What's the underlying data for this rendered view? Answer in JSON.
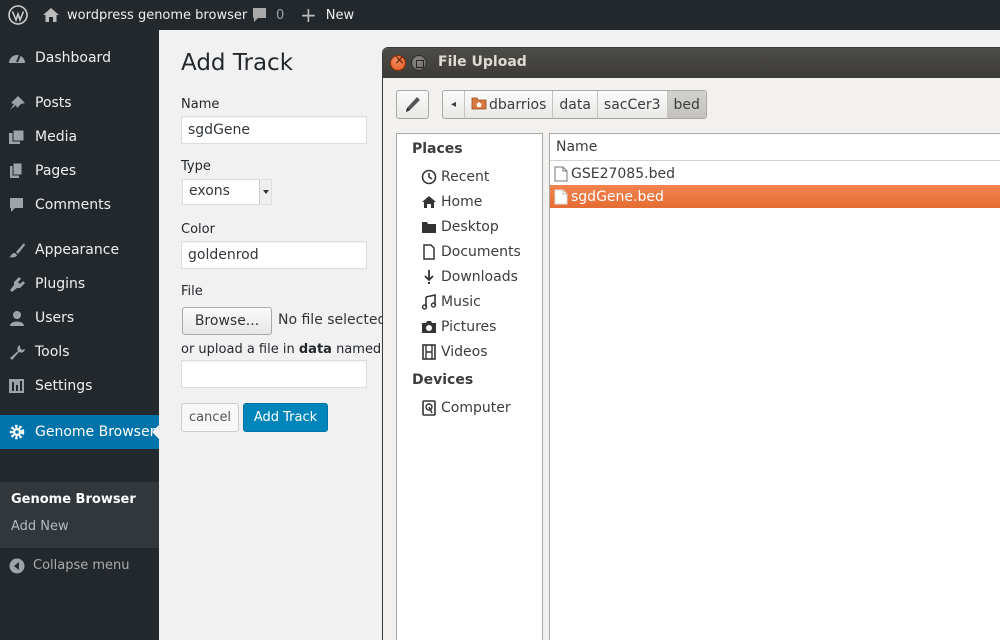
{
  "adminbar": {
    "site_name": "wordpress genome browser",
    "comments_count": "0",
    "new_label": "New"
  },
  "sidebar": {
    "items": [
      {
        "label": "Dashboard",
        "icon": "dashboard-icon"
      },
      {
        "label": "Posts",
        "icon": "pin-icon"
      },
      {
        "label": "Media",
        "icon": "media-icon"
      },
      {
        "label": "Pages",
        "icon": "pages-icon"
      },
      {
        "label": "Comments",
        "icon": "comment-icon"
      },
      {
        "label": "Appearance",
        "icon": "brush-icon"
      },
      {
        "label": "Plugins",
        "icon": "plug-icon"
      },
      {
        "label": "Users",
        "icon": "user-icon"
      },
      {
        "label": "Tools",
        "icon": "wrench-icon"
      },
      {
        "label": "Settings",
        "icon": "settings-icon"
      },
      {
        "label": "Genome Browser",
        "icon": "gear-icon"
      }
    ],
    "submenu": [
      "Genome Browser",
      "Add New"
    ],
    "collapse_label": "Collapse menu"
  },
  "form": {
    "title": "Add Track",
    "name_label": "Name",
    "name_value": "sgdGene",
    "type_label": "Type",
    "type_value": "exons",
    "color_label": "Color",
    "color_value": "goldenrod",
    "file_label": "File",
    "browse_label": "Browse...",
    "no_file_text": "No file selected.",
    "upload_note_pre": "or upload a file in ",
    "upload_note_bold": "data",
    "upload_note_post": " named:",
    "upload_value": "",
    "cancel_label": "cancel",
    "submit_label": "Add Track"
  },
  "dialog": {
    "title": "File Upload",
    "path": [
      "dbarrios",
      "data",
      "sacCer3",
      "bed"
    ],
    "places_header": "Places",
    "places": [
      {
        "label": "Recent",
        "icon": "clock-icon"
      },
      {
        "label": "Home",
        "icon": "home-icon"
      },
      {
        "label": "Desktop",
        "icon": "folder-icon"
      },
      {
        "label": "Documents",
        "icon": "document-icon"
      },
      {
        "label": "Downloads",
        "icon": "download-icon"
      },
      {
        "label": "Music",
        "icon": "music-icon"
      },
      {
        "label": "Pictures",
        "icon": "camera-icon"
      },
      {
        "label": "Videos",
        "icon": "film-icon"
      }
    ],
    "devices_header": "Devices",
    "devices": [
      {
        "label": "Computer",
        "icon": "drive-icon"
      }
    ],
    "column_name": "Name",
    "files": [
      {
        "name": "GSE27085.bed",
        "selected": false
      },
      {
        "name": "sgdGene.bed",
        "selected": true
      }
    ]
  },
  "colors": {
    "accent": "#0073aa",
    "selection": "#e96d33",
    "adminbar": "#23282d"
  }
}
